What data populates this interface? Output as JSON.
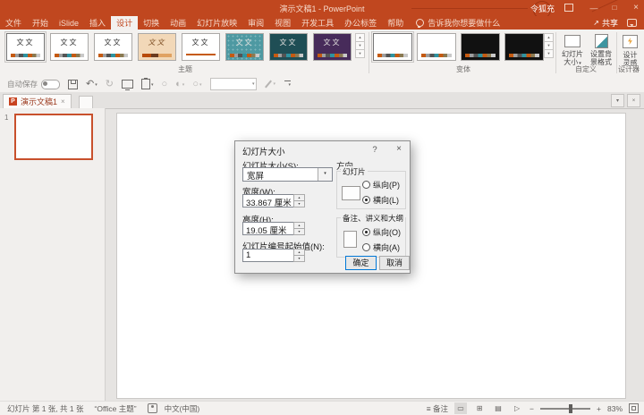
{
  "icons": {
    "close": "×",
    "minimize": "—",
    "maximize": "□",
    "collapse_ribbon": "^",
    "dropdown": "▾",
    "up_arrow": "▲",
    "down_arrow": "▼",
    "gallery_more": "▼",
    "undo": "↶",
    "redo": "↻",
    "share_arrow": "↗",
    "help": "?",
    "shapes": "○",
    "fill": "◐",
    "notes": "≡",
    "view_normal": "▭",
    "view_sorter": "⊞",
    "view_reading": "▤",
    "view_slideshow": "▷",
    "zoom_out": "−",
    "zoom_in": "+",
    "ppt_logo": "P"
  },
  "titlebar": {
    "title": "演示文稿1 - PowerPoint",
    "user": "令狐充"
  },
  "menu": {
    "tabs": [
      {
        "label": "文件"
      },
      {
        "label": "开始"
      },
      {
        "label": "iSlide"
      },
      {
        "label": "插入"
      },
      {
        "label": "设计"
      },
      {
        "label": "切换"
      },
      {
        "label": "动画"
      },
      {
        "label": "幻灯片放映"
      },
      {
        "label": "审阅"
      },
      {
        "label": "视图"
      },
      {
        "label": "开发工具"
      },
      {
        "label": "办公标签"
      },
      {
        "label": "帮助"
      }
    ],
    "tell_me": "告诉我你想要做什么",
    "share": "共享"
  },
  "ribbon": {
    "themes": {
      "label": "主题",
      "thumb_text": "文文"
    },
    "variants": {
      "label": "变体"
    },
    "customize": {
      "label": "自定义",
      "slide_size_line1": "幻灯片",
      "slide_size_line2": "大小",
      "format_bg_line1": "设置背",
      "format_bg_line2": "景格式"
    },
    "designer": {
      "label": "设计器",
      "line1": "设计",
      "line2": "灵感"
    }
  },
  "qat": {
    "autosave": "自动保存"
  },
  "doc_tabs": {
    "active_title": "演示文稿1"
  },
  "slides_panel": {
    "slide_number": "1"
  },
  "dialog": {
    "title": "幻灯片大小",
    "size_label": "幻灯片大小(S):",
    "size_value": "宽屏",
    "width_label": "宽度(W):",
    "width_value": "33.867 厘米",
    "height_label": "高度(H):",
    "height_value": "19.05 厘米",
    "start_number_label": "幻灯片编号起始值(N):",
    "start_number_value": "1",
    "orientation_label": "方向",
    "slides_group_label": "幻灯片",
    "slides_portrait": "纵向(P)",
    "slides_landscape": "横向(L)",
    "notes_group_label": "备注、讲义和大纲",
    "notes_portrait": "纵向(O)",
    "notes_landscape": "横向(A)",
    "ok": "确定",
    "cancel": "取消"
  },
  "statusbar": {
    "slide_info": "幻灯片 第 1 张, 共 1 张",
    "theme_name": "“Office 主题”",
    "language": "中文(中国)",
    "notes": "备注",
    "zoom_level": "83%"
  },
  "colors": {
    "titlebar": "#C0471F",
    "selection_border": "#C8502C",
    "default_button_border": "#0078D7"
  }
}
